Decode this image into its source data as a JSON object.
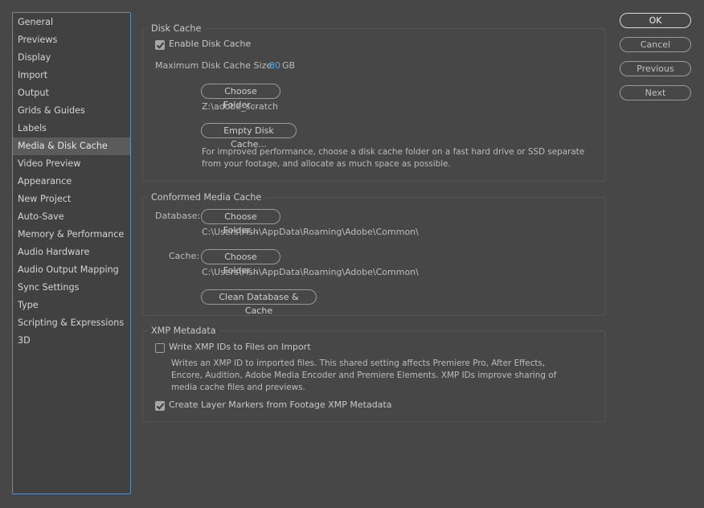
{
  "sidebar": {
    "items": [
      {
        "label": "General"
      },
      {
        "label": "Previews"
      },
      {
        "label": "Display"
      },
      {
        "label": "Import"
      },
      {
        "label": "Output"
      },
      {
        "label": "Grids & Guides"
      },
      {
        "label": "Labels"
      },
      {
        "label": "Media & Disk Cache",
        "selected": true
      },
      {
        "label": "Video Preview"
      },
      {
        "label": "Appearance"
      },
      {
        "label": "New Project"
      },
      {
        "label": "Auto-Save"
      },
      {
        "label": "Memory & Performance"
      },
      {
        "label": "Audio Hardware"
      },
      {
        "label": "Audio Output Mapping"
      },
      {
        "label": "Sync Settings"
      },
      {
        "label": "Type"
      },
      {
        "label": "Scripting & Expressions"
      },
      {
        "label": "3D"
      }
    ]
  },
  "disk_cache": {
    "title": "Disk Cache",
    "enable_label": "Enable Disk Cache",
    "enable_checked": true,
    "max_size_label": "Maximum Disk Cache Size:",
    "max_size_value": "80",
    "max_size_unit": "GB",
    "choose_folder": "Choose Folder...",
    "folder_path": "Z:\\adobe_scratch",
    "empty_button": "Empty Disk Cache...",
    "description": "For improved performance, choose a disk cache folder on a fast hard drive or SSD separate from your footage, and allocate as much space as possible."
  },
  "conformed": {
    "title": "Conformed Media Cache",
    "database_label": "Database:",
    "database_button": "Choose Folder...",
    "database_path": "C:\\Users\\Fish\\AppData\\Roaming\\Adobe\\Common\\",
    "cache_label": "Cache:",
    "cache_button": "Choose Folder...",
    "cache_path": "C:\\Users\\Fish\\AppData\\Roaming\\Adobe\\Common\\",
    "clean_button": "Clean Database & Cache"
  },
  "xmp": {
    "title": "XMP Metadata",
    "write_label": "Write XMP IDs to Files on Import",
    "write_checked": false,
    "write_description": "Writes an XMP ID to imported files. This shared setting affects Premiere Pro, After Effects, Encore, Audition, Adobe Media Encoder and Premiere Elements. XMP IDs improve sharing of media cache files and previews.",
    "layer_markers_label": "Create Layer Markers from Footage XMP Metadata",
    "layer_markers_checked": true
  },
  "dialog": {
    "ok": "OK",
    "cancel": "Cancel",
    "previous": "Previous",
    "next": "Next"
  },
  "colors": {
    "background": "#474747",
    "sidebar_border": "#5a8fbf",
    "accent_value": "#4aa6e6"
  }
}
